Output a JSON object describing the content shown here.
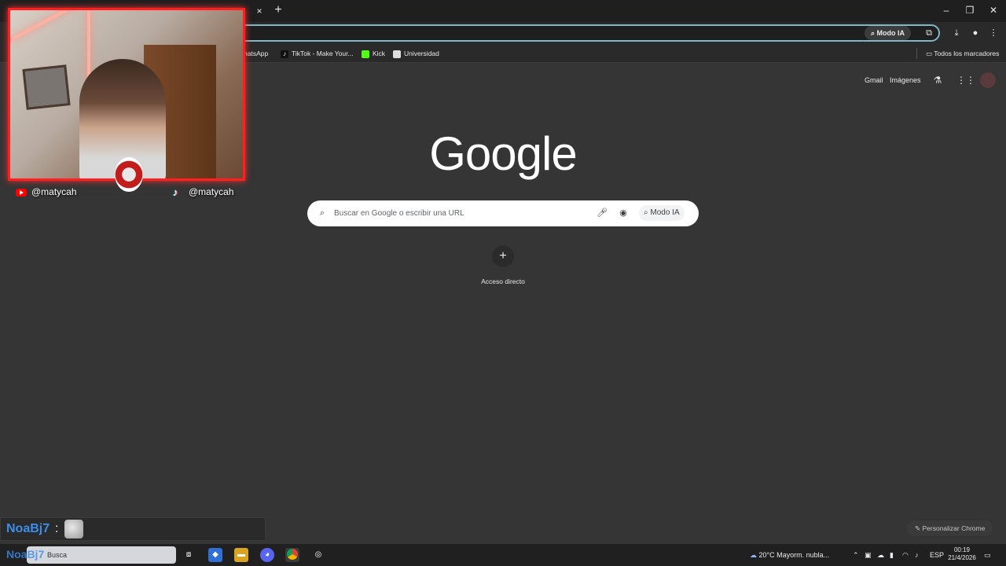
{
  "browser": {
    "tab_close": "×",
    "new_tab": "+",
    "window": {
      "minimize": "–",
      "restore": "❐",
      "close": "✕"
    },
    "toolbar": {
      "modo_ia": "Modo IA"
    },
    "bookmarks": [
      {
        "label": "hatsApp",
        "color": "#25d366"
      },
      {
        "label": "TikTok - Make Your...",
        "color": "#111111"
      },
      {
        "label": "Kick",
        "color": "#53fc18"
      },
      {
        "label": "Universidad",
        "color": "#dddddd"
      }
    ],
    "all_bookmarks": "Todos los marcadores"
  },
  "google": {
    "links": {
      "gmail": "Gmail",
      "images": "Imágenes"
    },
    "logo": "Google",
    "search": {
      "placeholder": "Buscar en Google o escribir una URL",
      "modo_ia": "Modo IA"
    },
    "shortcut": {
      "label": "Acceso directo"
    },
    "personalize": "Personalizar Chrome"
  },
  "overlay": {
    "youtube_handle": "@matycah",
    "tiktok_handle": "@matycah",
    "frame_color": "#ff1f1f",
    "chat": {
      "user": "NoaBj7",
      "separator": ":",
      "user_color": "#3b8de8"
    }
  },
  "taskbar": {
    "search_label": "Busca",
    "weather": "20°C  Mayorm. nubla...",
    "language": "ESP",
    "time": "00:19",
    "date": "21/4/2026"
  }
}
